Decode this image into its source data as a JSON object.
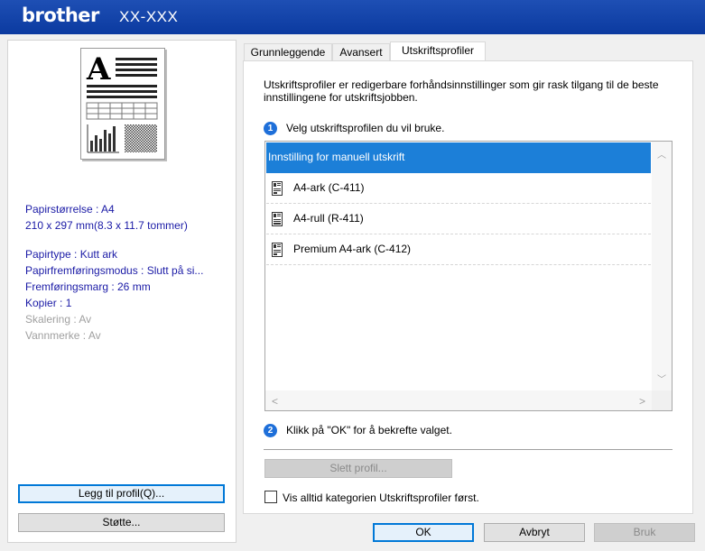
{
  "titlebar": {
    "brand": "brother",
    "model": "XX-XXX"
  },
  "info": {
    "paper_size": "Papirstørrelse : A4",
    "paper_dims": "210 x 297 mm(8.3 x 11.7 tommer)",
    "paper_type": "Papirtype : Kutt ark",
    "feed_mode": "Papirfremføringsmodus : Slutt på si...",
    "feed_margin": "Fremføringsmarg : 26 mm",
    "copies": "Kopier : 1",
    "scaling": "Skalering : Av",
    "watermark": "Vannmerke : Av"
  },
  "left_buttons": {
    "add_profile": "Legg til profil(Q)...",
    "support": "Støtte..."
  },
  "tabs": [
    "Grunnleggende",
    "Avansert",
    "Utskriftsprofiler"
  ],
  "panel": {
    "description": "Utskriftsprofiler er redigerbare forhåndsinnstillinger som gir rask tilgang til de beste innstillingene for utskriftsjobben.",
    "step1_num": "1",
    "step1": "Velg utskriftsprofilen du vil bruke.",
    "profiles": [
      "Innstilling for manuell utskrift",
      "A4-ark (C-411)",
      "A4-rull (R-411)",
      "Premium A4-ark (C-412)"
    ],
    "step2_num": "2",
    "step2": "Klikk på \"OK\" for å bekrefte valget.",
    "delete_profile": "Slett profil...",
    "always_show": "Vis alltid kategorien Utskriftsprofiler først."
  },
  "footer": {
    "ok": "OK",
    "cancel": "Avbryt",
    "apply": "Bruk"
  },
  "colors": {
    "titlebar": "#0b3aa0",
    "selection": "#1c7fd8",
    "info_text": "#1a1aa6"
  }
}
